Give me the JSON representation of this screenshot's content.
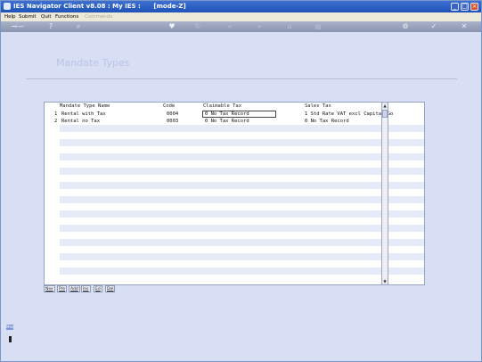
{
  "window": {
    "title": "IES Navigator Client v8.08 : My IES :      [mode-Z]"
  },
  "menu": [
    "Help",
    "Submit",
    "Quit",
    "Functions",
    "Commands"
  ],
  "page": {
    "title": "Mandate Types"
  },
  "table": {
    "columns": [
      "Mandate Type Name",
      "Code",
      "Claimable Tax",
      "Sales Tax"
    ],
    "rows": [
      {
        "num": "1",
        "name": "Rental with Tax",
        "code": "0004",
        "claimable": "0 No Tax Record",
        "sales": "1 Std Rate VAT excl Capital Go"
      },
      {
        "num": "2",
        "name": "Rental no Tax",
        "code": "0003",
        "claimable": "0 No Tax Record",
        "sales": "0 No Tax Record"
      }
    ]
  },
  "actions": [
    "Nex",
    "Pre",
    "Add",
    "Ins",
    "Ed",
    "Del"
  ],
  "side": {
    "label": "Men"
  }
}
